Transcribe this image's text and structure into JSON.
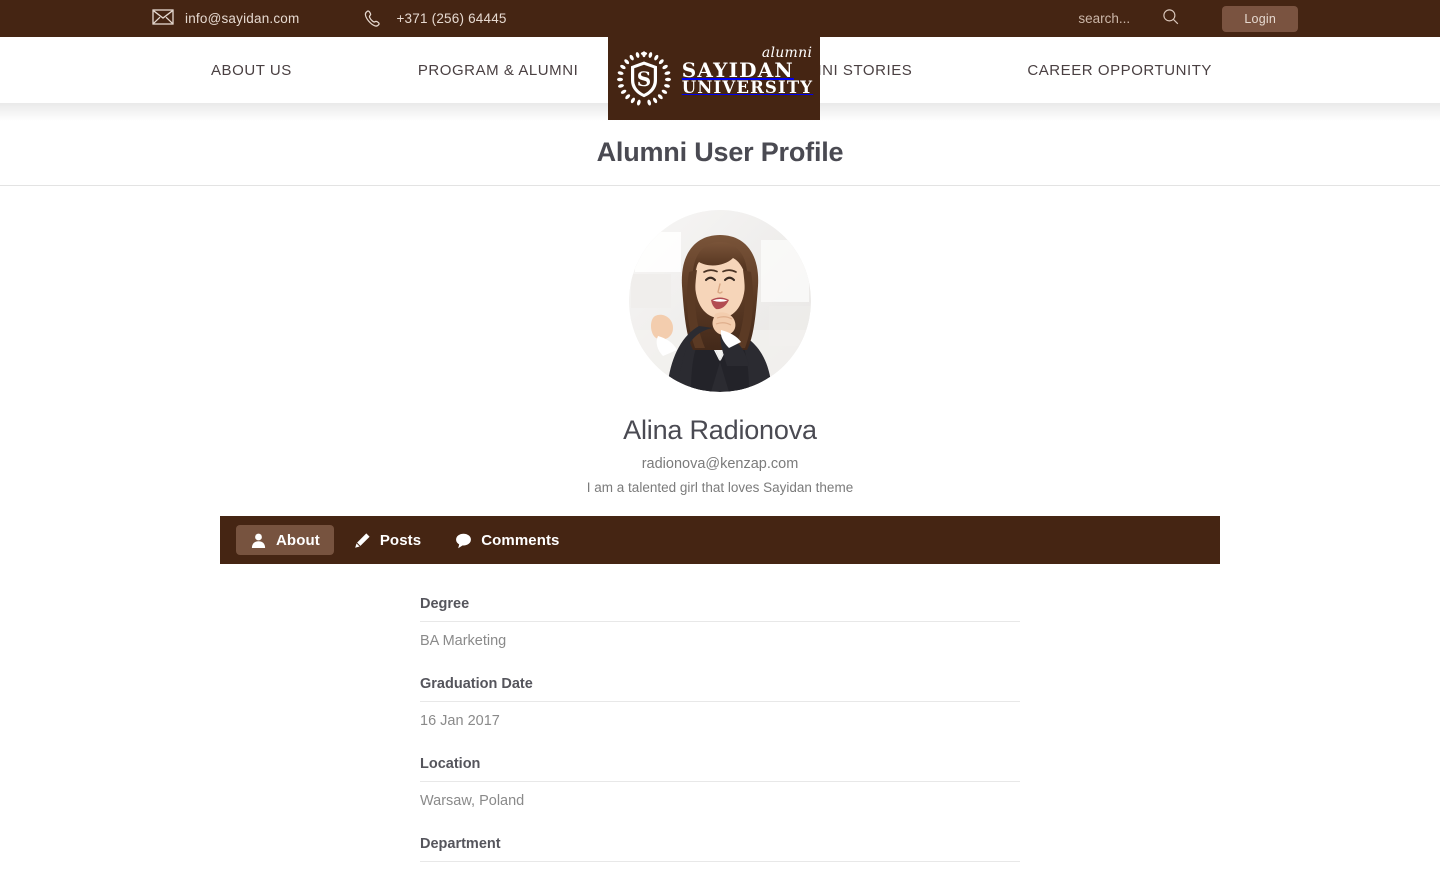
{
  "topbar": {
    "email": "info@sayidan.com",
    "phone": "+371 (256) 64445",
    "email_icon": "envelope-icon",
    "phone_icon": "phone-icon",
    "search_placeholder": "search...",
    "search_value": "",
    "search_icon": "search-icon",
    "login_label": "Login",
    "bg_color": "#452513"
  },
  "logo": {
    "script_word": "alumni",
    "line1": "SAYIDAN",
    "line2": "UNIVERSITY",
    "emblem_icon": "laurel-shield-s-icon",
    "bg_color": "#452513"
  },
  "nav": {
    "left_items": [
      {
        "label": "ABOUT US"
      },
      {
        "label": "PROGRAM & ALUMNI"
      }
    ],
    "right_items": [
      {
        "label": "ALUMNI STORIES"
      },
      {
        "label": "CAREER OPPORTUNITY"
      }
    ]
  },
  "page": {
    "title": "Alumni User Profile"
  },
  "profile": {
    "avatar_alt": "smiling-woman-portrait",
    "name": "Alina Radionova",
    "email": "radionova@kenzap.com",
    "bio": "I am a talented girl that loves Sayidan theme"
  },
  "tabs": [
    {
      "label": "About",
      "icon": "user-icon",
      "active": true
    },
    {
      "label": "Posts",
      "icon": "pencil-icon",
      "active": false
    },
    {
      "label": "Comments",
      "icon": "comment-icon",
      "active": false
    }
  ],
  "details": [
    {
      "label": "Degree",
      "value": "BA Marketing"
    },
    {
      "label": "Graduation Date",
      "value": "16 Jan 2017"
    },
    {
      "label": "Location",
      "value": "Warsaw, Poland"
    },
    {
      "label": "Department",
      "value": ""
    }
  ],
  "colors": {
    "brand_brown": "#452513",
    "accent_brown": "#77533f",
    "text_dark": "#4a4a52",
    "text_muted": "#8a8a8a"
  }
}
